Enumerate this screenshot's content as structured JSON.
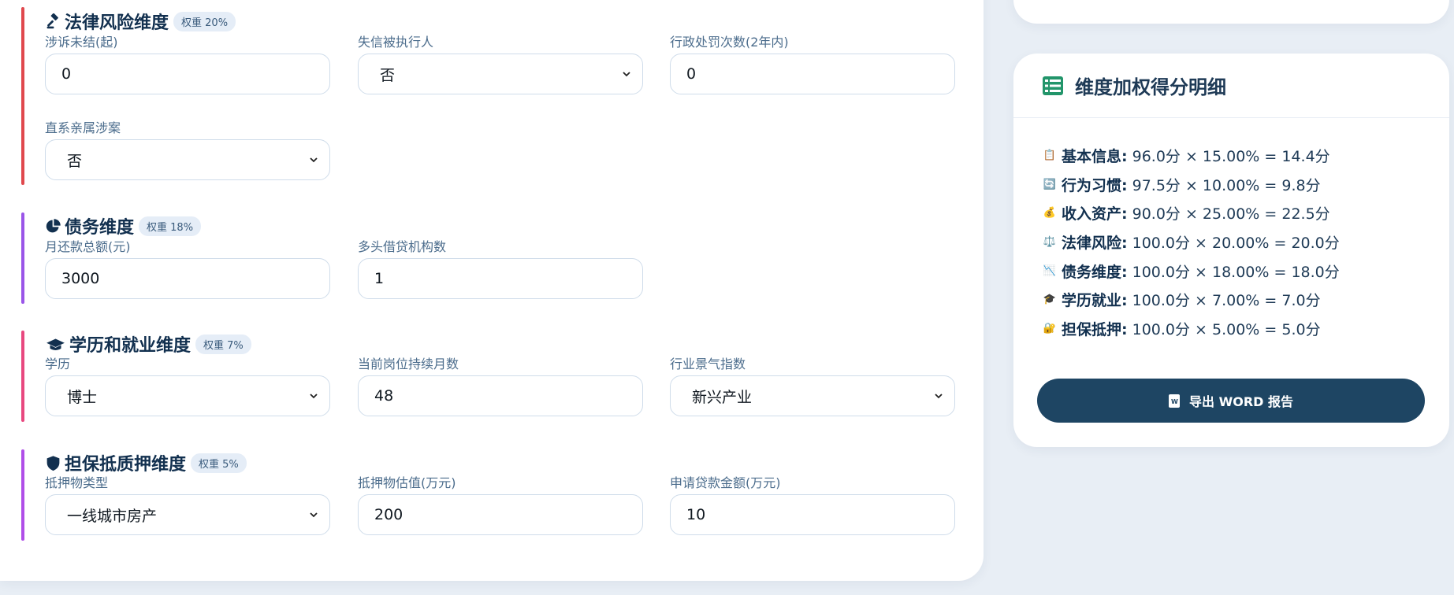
{
  "colors": {
    "legal_bar": "#e0484d",
    "debt_bar": "#9a55e8",
    "edu_bar": "#e8487f",
    "guarantee_bar": "#b04ee8",
    "export_button": "#1e4563",
    "sheet_icon": "#22956a"
  },
  "legal": {
    "icon": "gavel-icon",
    "title": "法律风险维度",
    "weight": "权重 20%",
    "lawsuit_label": "涉诉未结(起)",
    "lawsuit_value": "0",
    "dishonest_label": "失信被执行人",
    "dishonest_value": "否",
    "penalty_label": "行政处罚次数(2年内)",
    "penalty_value": "0",
    "relative_label": "直系亲属涉案",
    "relative_value": "否"
  },
  "debt": {
    "icon": "pie-chart-icon",
    "title": "债务维度",
    "weight": "权重 18%",
    "monthly_label": "月还款总额(元)",
    "monthly_value": "3000",
    "lenders_label": "多头借贷机构数",
    "lenders_value": "1"
  },
  "education": {
    "icon": "graduation-cap-icon",
    "title": "学历和就业维度",
    "weight": "权重 7%",
    "degree_label": "学历",
    "degree_value": "博士",
    "months_label": "当前岗位持续月数",
    "months_value": "48",
    "industry_label": "行业景气指数",
    "industry_value": "新兴产业"
  },
  "guarantee": {
    "icon": "shield-icon",
    "title": "担保抵质押维度",
    "weight": "权重 5%",
    "type_label": "抵押物类型",
    "type_value": "一线城市房产",
    "collateral_label": "抵押物估值(万元)",
    "collateral_value": "200",
    "loan_label": "申请贷款金额(万元)",
    "loan_value": "10"
  },
  "summary": {
    "icon": "table-list-icon",
    "title": "维度加权得分明细",
    "items": [
      {
        "emoji": "📋",
        "name": "基本信息:",
        "detail": "96.0分 × 15.00% = 14.4分"
      },
      {
        "emoji": "🔄",
        "name": "行为习惯:",
        "detail": "97.5分 × 10.00% = 9.8分"
      },
      {
        "emoji": "💰",
        "name": "收入资产:",
        "detail": "90.0分 × 25.00% = 22.5分"
      },
      {
        "emoji": "⚖️",
        "name": "法律风险:",
        "detail": "100.0分 × 20.00% = 20.0分"
      },
      {
        "emoji": "📉",
        "name": "债务维度:",
        "detail": "100.0分 × 18.00% = 18.0分"
      },
      {
        "emoji": "🎓",
        "name": "学历就业:",
        "detail": "100.0分 × 7.00% = 7.0分"
      },
      {
        "emoji": "🔐",
        "name": "担保抵押:",
        "detail": "100.0分 × 5.00% = 5.0分"
      }
    ],
    "export_label": "导出 WORD 报告",
    "export_icon_letter": "W"
  }
}
